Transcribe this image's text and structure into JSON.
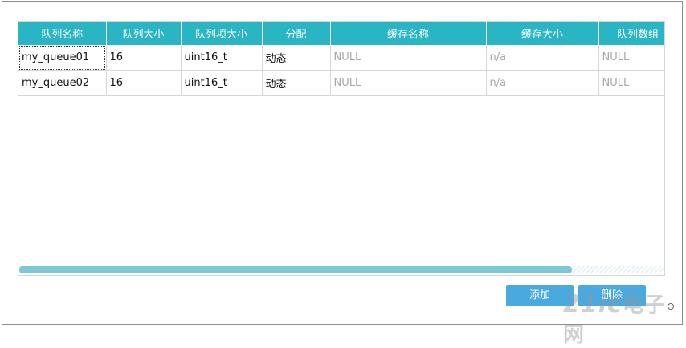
{
  "table": {
    "headers": [
      "队列名称",
      "队列大小",
      "队列项大小",
      "分配",
      "缓存名称",
      "缓存大小",
      "队列数组"
    ],
    "rows": [
      [
        "my_queue01",
        "16",
        "uint16_t",
        "动态",
        "NULL",
        "n/a",
        "NULL"
      ],
      [
        "my_queue02",
        "16",
        "uint16_t",
        "动态",
        "NULL",
        "n/a",
        "NULL"
      ]
    ]
  },
  "buttons": {
    "add_label": "添加",
    "delete_label": "删除"
  },
  "watermark": {
    "text": "21ic",
    "cn_text": "电子网"
  },
  "colors": {
    "header_bg": "#29b5c3",
    "button_bg": "#4aa9de",
    "scroll_thumb": "#7cc9d5",
    "muted_text": "#a8a8a8"
  },
  "scrollbar": {
    "thumb_fraction": 0.86
  }
}
